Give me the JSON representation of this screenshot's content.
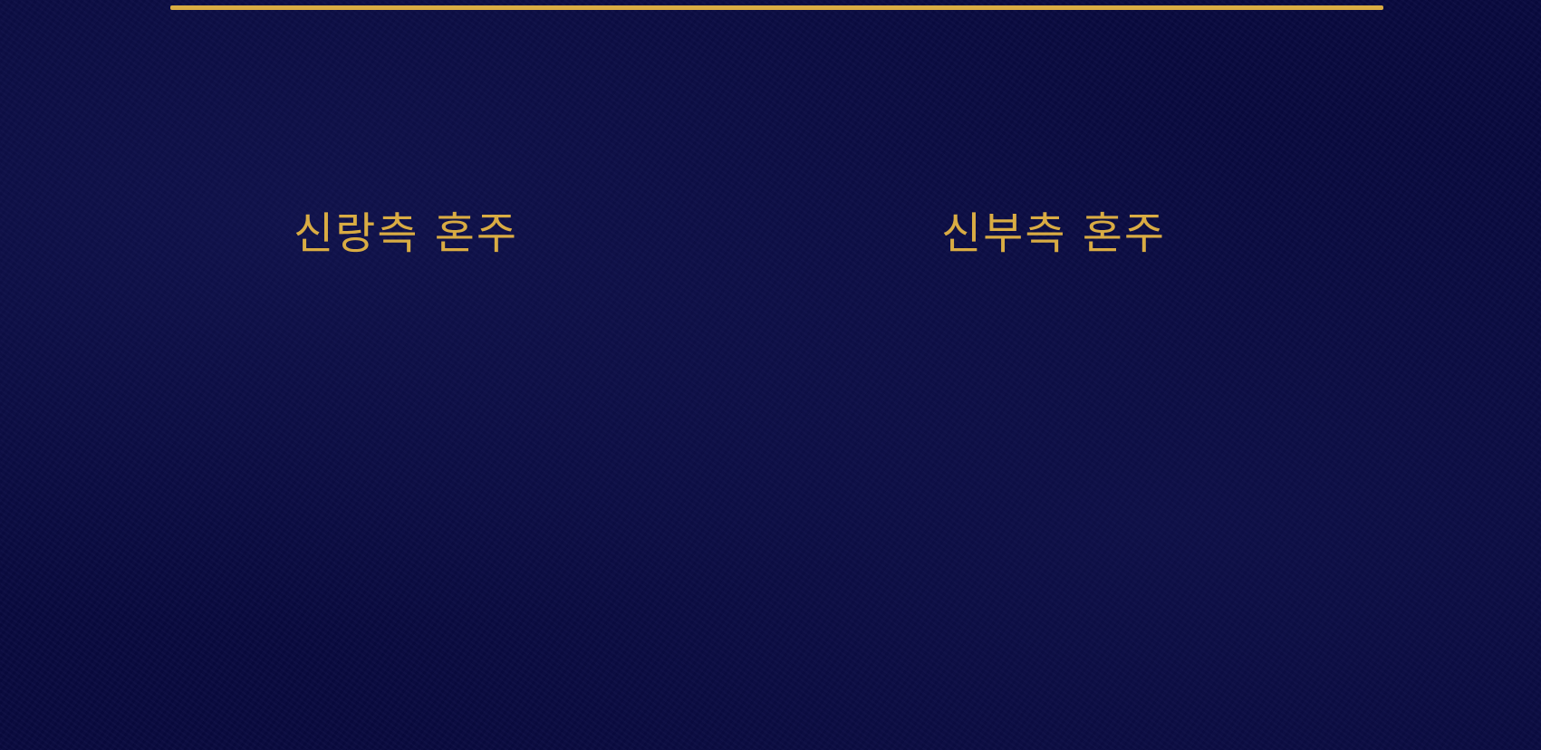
{
  "colors": {
    "background": "#08093f",
    "gold": "#d9ac43"
  },
  "hosts": {
    "groom_label": "신랑측 혼주",
    "bride_label": "신부측 혼주"
  }
}
